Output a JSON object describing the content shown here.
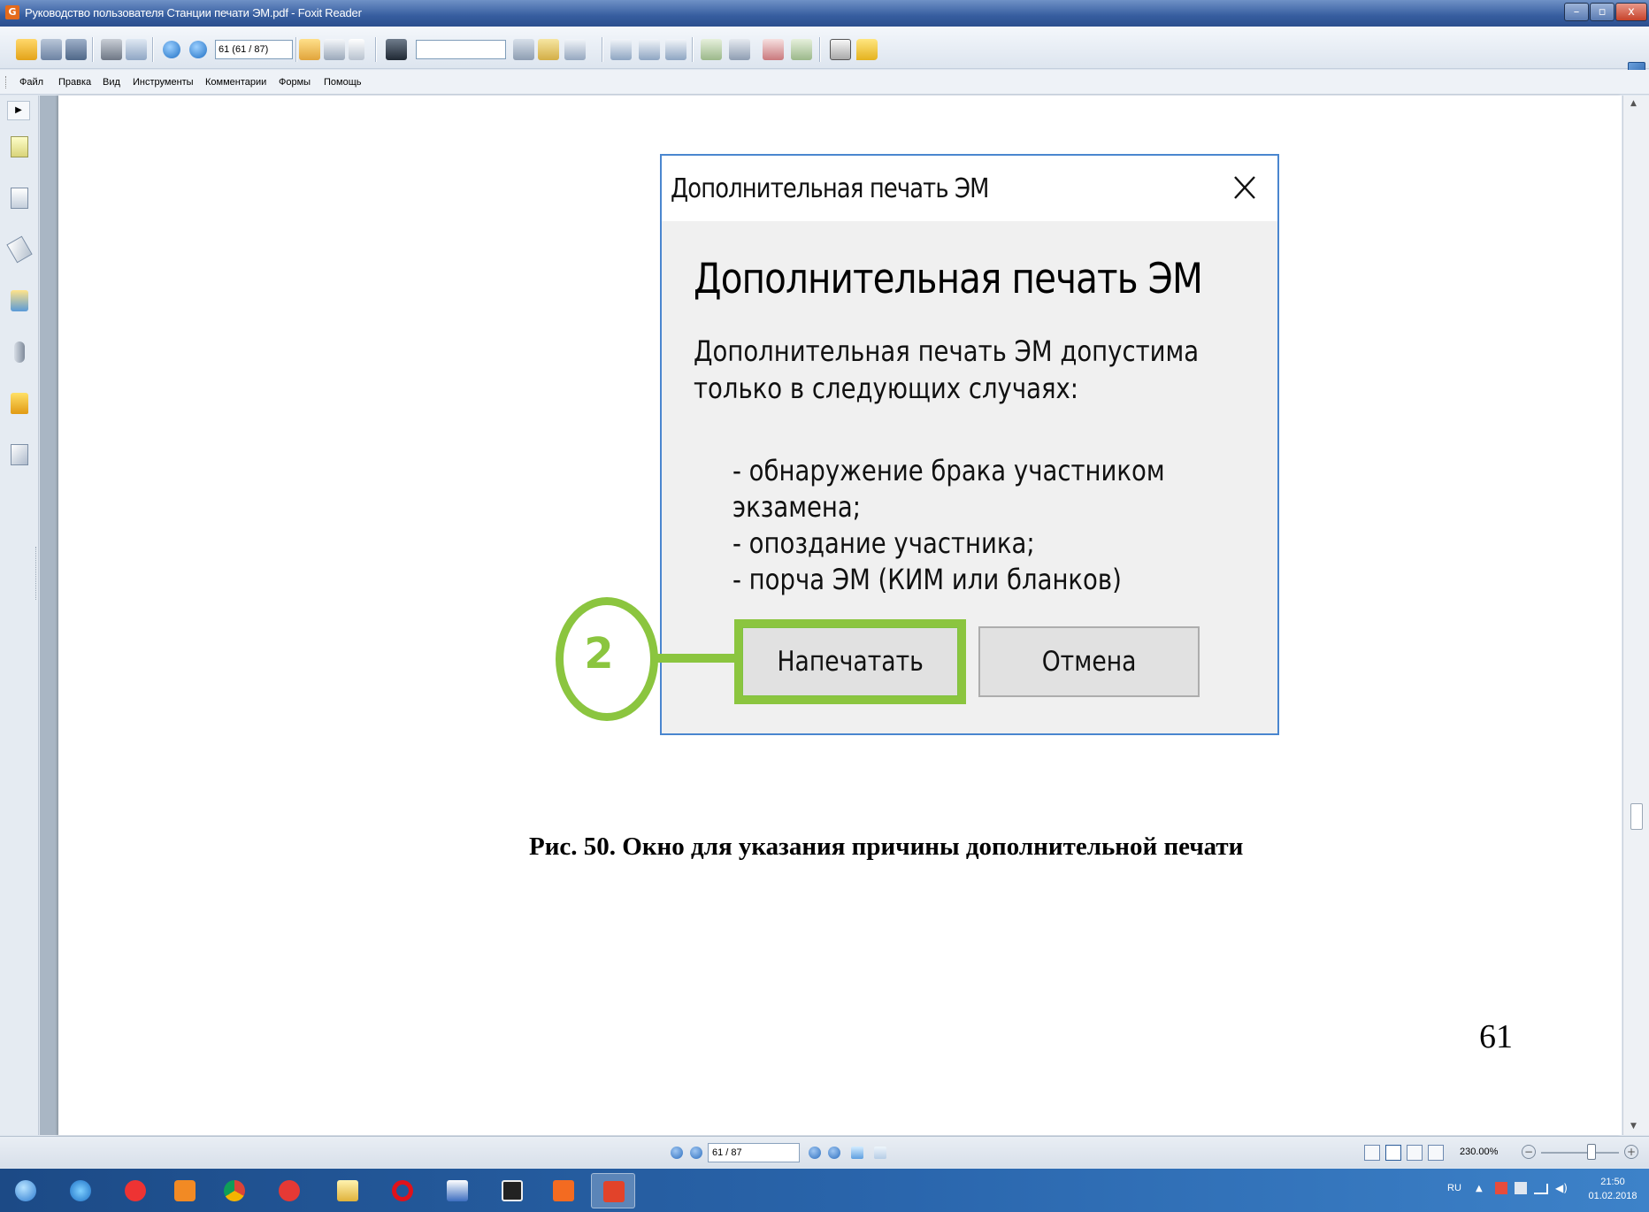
{
  "window": {
    "logo_letter": "G",
    "title": "Руководство пользователя Станции печати ЭМ.pdf - Foxit Reader",
    "min_glyph": "–",
    "max_glyph": "▫",
    "close_glyph": "x"
  },
  "toolbar": {
    "page_field_value": "61 (61 / 87)",
    "search_value": ""
  },
  "menu": {
    "items": [
      "Файл",
      "Правка",
      "Вид",
      "Инструменты",
      "Комментарии",
      "Формы",
      "Помощь"
    ]
  },
  "nav_panel": {
    "toggle_glyph": "▶",
    "icons": [
      "pages-icon",
      "document-icon",
      "layers-icon",
      "comments-icon",
      "attachments-icon",
      "security-icon",
      "signature-icon"
    ]
  },
  "document": {
    "figure_dialog": {
      "title": "Дополнительная печать ЭМ",
      "heading": "Дополнительная печать ЭМ",
      "message": "Дополнительная печать ЭМ допустима только в следующих случаях:",
      "reasons": [
        "- обнаружение брака участником",
        "экзамена;",
        "- опоздание участника;",
        "- порча ЭМ (КИМ или бланков)"
      ],
      "print_button": "Напечатать",
      "cancel_button": "Отмена",
      "highlight_color": "#8bc53f"
    },
    "step_marker": "2",
    "caption": "Рис. 50. Окно для указания причины дополнительной печати",
    "page_number": "61"
  },
  "statusbar": {
    "page_value": "61 / 87",
    "zoom_value": "230.00%",
    "zoom_level_percent": 230
  },
  "taskbar": {
    "apps": [
      "start-orb-icon",
      "internet-explorer-icon",
      "yandex-icon",
      "media-player-icon",
      "chrome-icon",
      "yandex-browser-icon",
      "file-manager-icon",
      "opera-icon",
      "word-icon",
      "7zip-icon",
      "foxit-pdf-icon",
      "foxit-reader-icon"
    ],
    "active_app": "foxit-reader-icon",
    "language": "RU",
    "time": "21:50",
    "date": "01.02.2018"
  },
  "colors": {
    "accent_green": "#8bc53f",
    "dialog_border": "#4a86cf",
    "titlebar": "#365d9f"
  }
}
